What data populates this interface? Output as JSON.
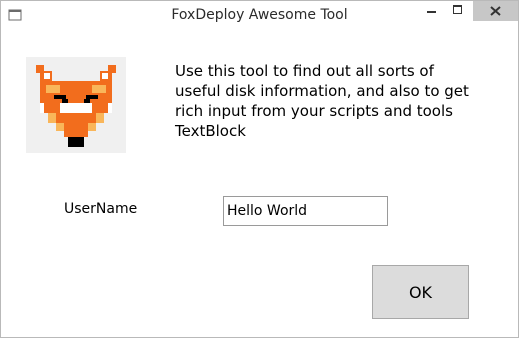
{
  "window": {
    "title": "FoxDeploy Awesome Tool",
    "controls": {
      "minimize_icon": "minimize-icon",
      "maximize_icon": "maximize-icon",
      "close_icon": "close-icon"
    }
  },
  "logo": {
    "icon": "fox-icon",
    "colors": {
      "orange": "#f26d1d",
      "light_orange": "#f9b65a",
      "white": "#ffffff",
      "black": "#000000",
      "background": "#f0f0f0"
    }
  },
  "description": {
    "lines": [
      "Use this tool to find out all sorts of",
      "useful disk information, and also to get",
      "rich input from your scripts and tools",
      "TextBlock"
    ]
  },
  "form": {
    "username_label": "UserName",
    "username_value": "Hello World"
  },
  "ok_button": {
    "label": "OK"
  }
}
